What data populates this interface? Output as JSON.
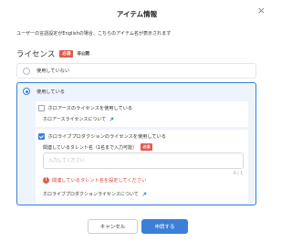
{
  "dialog": {
    "title": "アイテム情報",
    "close_icon": "×",
    "notice": "ユーザーの言語設定がEnglishの場合、こちらのアイテム名が表示されます"
  },
  "license": {
    "label": "ライセンス",
    "required_badge": "必須",
    "private_badge": "非公開",
    "option_none": "使用していない",
    "option_use": "使用している",
    "hololive_ars": {
      "label": "ホロアースのライセンスを使用している",
      "checked": false,
      "link": "ホロアースライセンスについて"
    },
    "hololive_production": {
      "label": "ホロライブプロダクションのライセンスを使用している",
      "checked": true,
      "talent_label": "関連しているタレント名（1名まで入力可能）",
      "talent_required_badge": "必須",
      "talent_placeholder": "入力してください",
      "counter": "0 / 1",
      "error": "関連しているタレント名を設定してください",
      "link": "ホロライブプロダクションライセンスについて"
    }
  },
  "footer": {
    "cancel_label": "キャンセル",
    "apply_label": "申請する"
  },
  "colors": {
    "accent": "#3b7fd6",
    "error": "#e25a4a",
    "selected_bg": "#eef4fc"
  }
}
